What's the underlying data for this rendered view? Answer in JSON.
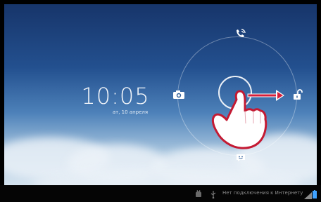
{
  "lockscreen": {
    "time": "10:05",
    "date": "ат, 10 апреля"
  },
  "targets": {
    "phone_icon": "phone-icon",
    "camera_icon": "camera-icon",
    "unlock_icon": "unlock-icon",
    "message_icon": "message-icon"
  },
  "status_bar": {
    "network_text": "Нет подключения к Интернету"
  },
  "colors": {
    "accent_arrow": "#d71f3a",
    "status_bar_bg": "#050505",
    "battery": "#3fa2ff",
    "signal": "#8a8a8a"
  }
}
